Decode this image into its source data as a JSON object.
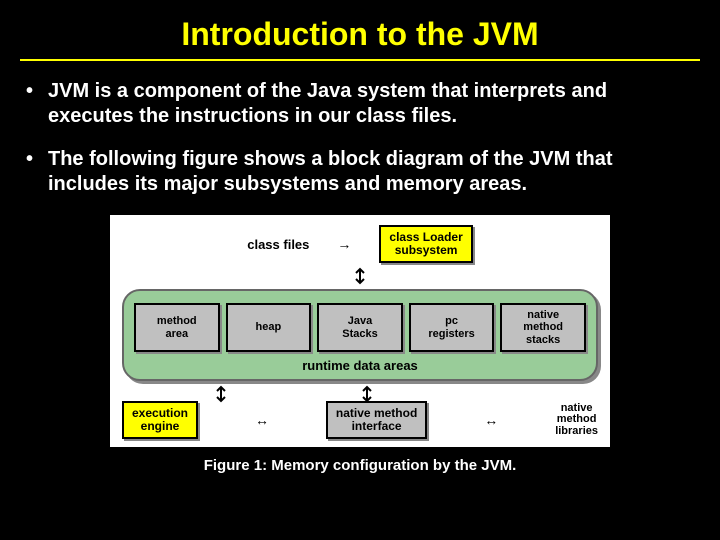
{
  "title": "Introduction to the JVM",
  "bullets": [
    "JVM is a component of the Java system that interprets and executes the instructions in our class files.",
    "The following figure shows a block diagram of the JVM that includes its major subsystems and memory areas."
  ],
  "diagram": {
    "class_files_label": "class files",
    "class_loader": "class Loader\nsubsystem",
    "runtime": {
      "boxes": [
        "method\narea",
        "heap",
        "Java\nStacks",
        "pc\nregisters",
        "native\nmethod\nstacks"
      ],
      "label": "runtime data areas"
    },
    "execution_engine": "execution\nengine",
    "native_method_interface": "native method\ninterface",
    "native_method_libraries": "native\nmethod\nlibraries"
  },
  "caption": "Figure 1: Memory configuration by the JVM."
}
